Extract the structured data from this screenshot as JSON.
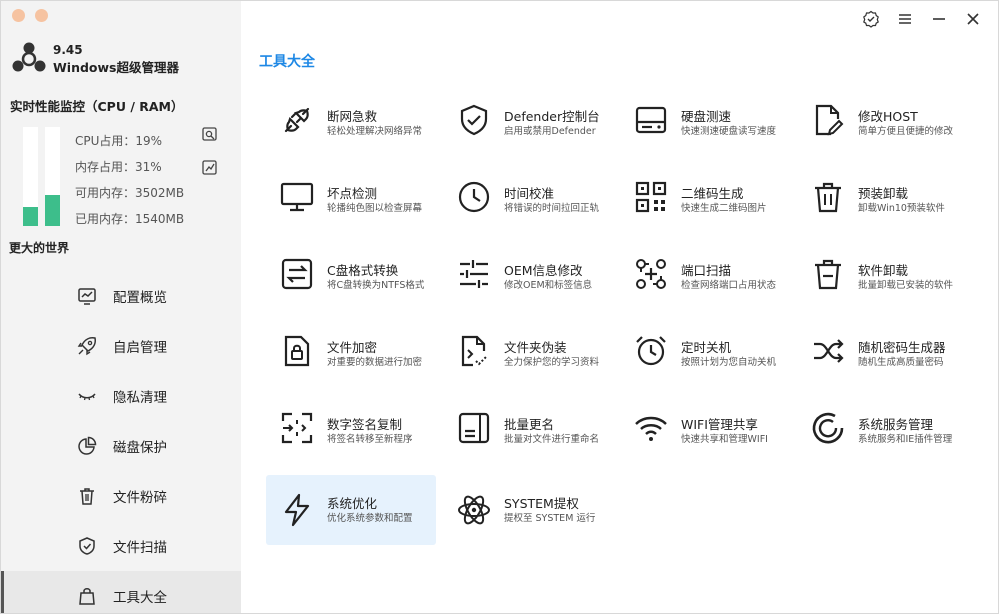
{
  "app": {
    "version": "9.45",
    "name": "Windows超级管理器"
  },
  "monitor": {
    "title": "实时性能监控（CPU / RAM）",
    "cpu_fill": 0.19,
    "ram_fill": 0.31,
    "stats": [
      {
        "label": "CPU占用：19%"
      },
      {
        "label": "内存占用：31%"
      },
      {
        "label": "可用内存：3502MB"
      },
      {
        "label": "已用内存：1540MB"
      }
    ],
    "bar_color": "#3dbe8b"
  },
  "slogan": "更大的世界",
  "nav": [
    {
      "label": "配置概览",
      "icon": "chart-monitor-icon"
    },
    {
      "label": "自启管理",
      "icon": "rocket-icon"
    },
    {
      "label": "隐私清理",
      "icon": "eye-closed-icon"
    },
    {
      "label": "磁盘保护",
      "icon": "pie-chart-icon"
    },
    {
      "label": "文件粉碎",
      "icon": "trash-icon"
    },
    {
      "label": "文件扫描",
      "icon": "shield-icon"
    },
    {
      "label": "工具大全",
      "icon": "bag-icon"
    }
  ],
  "active_nav": "工具大全",
  "page_title": "工具大全",
  "accent_color": "#1e88e5",
  "tools": [
    {
      "title": "断网急救",
      "desc": "轻松处理解决网络异常",
      "icon": "plug-icon"
    },
    {
      "title": "Defender控制台",
      "desc": "启用或禁用Defender",
      "icon": "shield-check-icon"
    },
    {
      "title": "硬盘测速",
      "desc": "快速测速硬盘读写速度",
      "icon": "hard-drive-icon"
    },
    {
      "title": "修改HOST",
      "desc": "简单方便且便捷的修改",
      "icon": "file-edit-icon"
    },
    {
      "title": "坏点检测",
      "desc": "轮播纯色图以检查屏幕",
      "icon": "monitor-icon"
    },
    {
      "title": "时间校准",
      "desc": "将错误的时间拉回正轨",
      "icon": "clock-icon"
    },
    {
      "title": "二维码生成",
      "desc": "快速生成二维码图片",
      "icon": "qr-code-icon"
    },
    {
      "title": "预装卸载",
      "desc": "卸载Win10预装软件",
      "icon": "trash-icon"
    },
    {
      "title": "C盘格式转换",
      "desc": "将C盘转换为NTFS格式",
      "icon": "swap-icon"
    },
    {
      "title": "OEM信息修改",
      "desc": "修改OEM和标签信息",
      "icon": "sliders-icon"
    },
    {
      "title": "端口扫描",
      "desc": "检查网络端口占用状态",
      "icon": "port-scan-icon"
    },
    {
      "title": "软件卸载",
      "desc": "批量卸载已安装的软件",
      "icon": "trash-minus-icon"
    },
    {
      "title": "文件加密",
      "desc": "对重要的数据进行加密",
      "icon": "file-lock-icon"
    },
    {
      "title": "文件夹伪装",
      "desc": "全力保护您的学习资料",
      "icon": "file-hidden-icon"
    },
    {
      "title": "定时关机",
      "desc": "按照计划为您自动关机",
      "icon": "alarm-icon"
    },
    {
      "title": "随机密码生成器",
      "desc": "随机生成高质量密码",
      "icon": "shuffle-icon"
    },
    {
      "title": "数字签名复制",
      "desc": "将签名转移至新程序",
      "icon": "signature-copy-icon"
    },
    {
      "title": "批量更名",
      "desc": "批量对文件进行重命名",
      "icon": "rename-icon"
    },
    {
      "title": "WIFI管理共享",
      "desc": "快速共享和管理WIFI",
      "icon": "wifi-icon"
    },
    {
      "title": "系统服务管理",
      "desc": "系统服务和IE插件管理",
      "icon": "service-icon"
    },
    {
      "title": "系统优化",
      "desc": "优化系统参数和配置",
      "icon": "lightning-icon"
    },
    {
      "title": "SYSTEM提权",
      "desc": "提权至 SYSTEM 运行",
      "icon": "atom-icon"
    }
  ],
  "active_tool": "系统优化",
  "window_controls": [
    {
      "icon": "badge-check-icon"
    },
    {
      "icon": "menu-icon"
    },
    {
      "icon": "minimize-icon"
    },
    {
      "icon": "close-icon"
    }
  ]
}
